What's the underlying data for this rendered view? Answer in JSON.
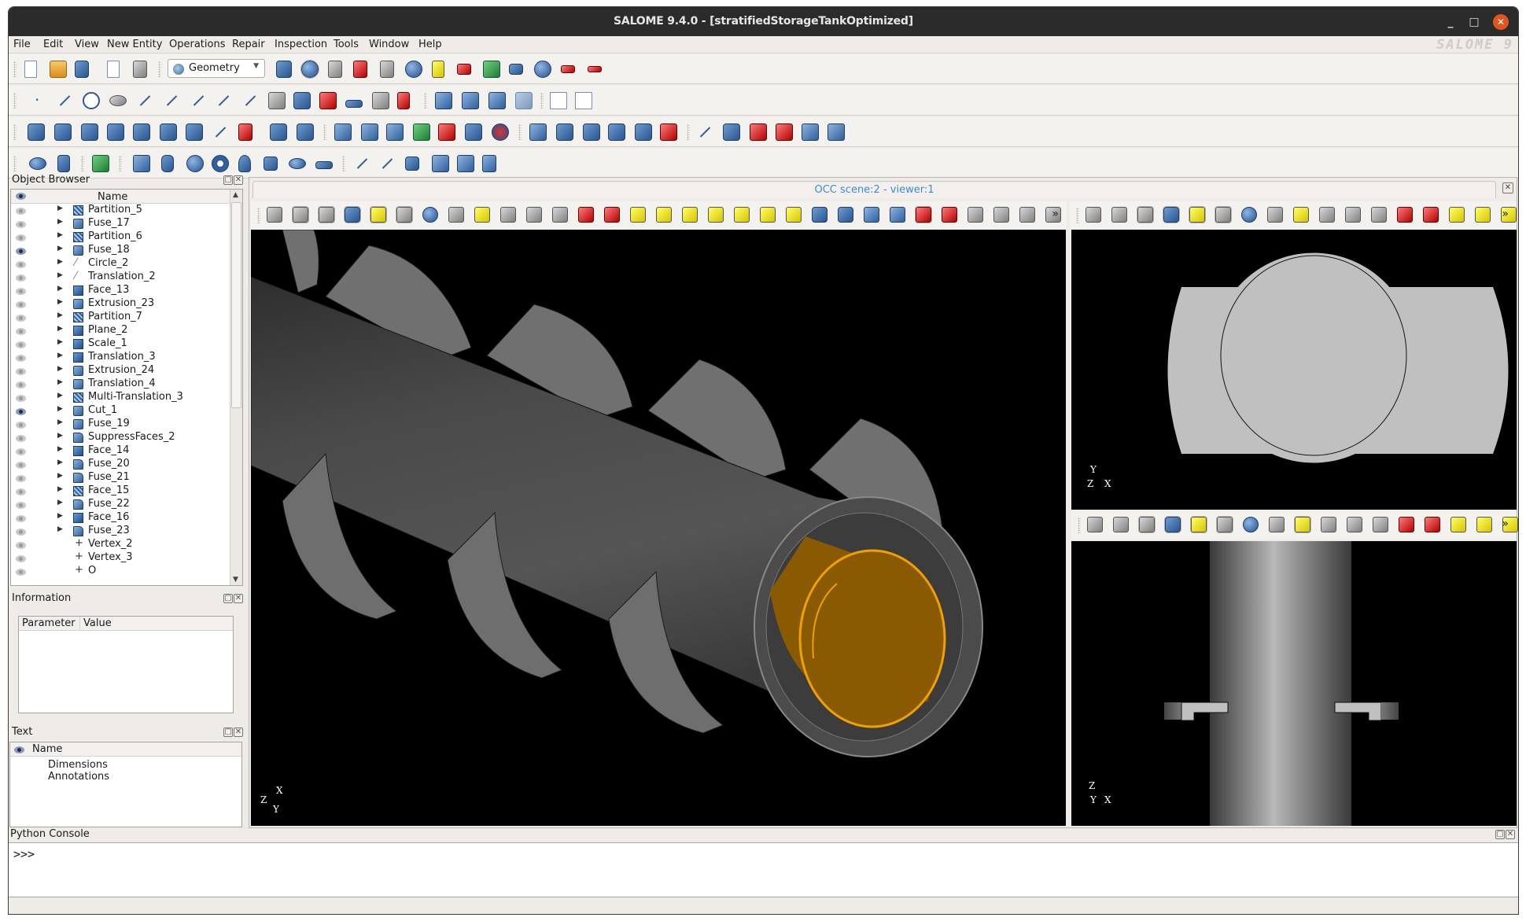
{
  "window": {
    "title": "SALOME  9.4.0 - [stratifiedStorageTankOptimized]",
    "controls": {
      "minimize": "_",
      "maximize": "□",
      "close": "✕"
    }
  },
  "menu": {
    "items": [
      "File",
      "Edit",
      "View",
      "New Entity",
      "Operations",
      "Repair",
      "Inspection",
      "Tools",
      "Window",
      "Help"
    ],
    "logo": "SALOME 9"
  },
  "toolbar": {
    "module_select": {
      "value": "Geometry",
      "icon": "geometry-icon"
    },
    "row1_icons": [
      "new-document-icon",
      "open-folder-icon",
      "save-icon",
      "copy-icon",
      "paste-icon",
      "shaper-icon",
      "geometry-icon",
      "smesh-icon",
      "paravis-icon",
      "yacs-icon",
      "jobmanager-icon",
      "homard-icon",
      "adao-icon",
      "fields-icon",
      "eficas-icon",
      "gear-icon",
      "tube-icon",
      "network-icon"
    ],
    "row2_icons": [
      "point-icon",
      "line-icon",
      "circle-icon",
      "ellipse-icon",
      "arc-icon",
      "curve-icon",
      "vector-icon",
      "plane-icon",
      "polyline-icon",
      "sketch-icon",
      "surface-icon",
      "working-plane-icon",
      "plane-lcs-icon",
      "lcs-icon",
      "lcs-axes-icon",
      "group-icon",
      "group-union-icon",
      "group-intersect-icon",
      "group-cut-icon",
      "picture-icon",
      "picture-export-icon"
    ],
    "row3_icons": [
      "translation-icon",
      "rotation-icon",
      "mirror-icon",
      "scale-icon",
      "offset-icon",
      "projection-icon",
      "projection-cylinder-icon",
      "extend-curve-icon",
      "position-icon",
      "multi-translation-icon",
      "multi-rotation-icon",
      "fuse-icon",
      "common-icon",
      "cut-icon",
      "section-icon",
      "partition-icon",
      "glue-icon",
      "shape-process-icon",
      "extrusion-icon",
      "revolution-icon",
      "filling-icon",
      "pipe-icon",
      "pipe-path-icon",
      "thickness-icon",
      "fillet-1d-icon",
      "fillet-icon",
      "chamfer-icon",
      "extrude-face-icon",
      "box-feature-icon",
      "hole-icon"
    ],
    "row4_icons": [
      "sphere-grid-icon",
      "cylinder-grid-icon",
      "surface-patch-icon",
      "box-icon",
      "cylinder-icon",
      "sphere-icon",
      "torus-icon",
      "cone-icon",
      "rectangle-icon",
      "disk-icon",
      "t-shape-icon",
      "edge-icon",
      "wire-icon",
      "face-icon",
      "shell-icon",
      "solid-icon",
      "compound-icon"
    ]
  },
  "object_browser": {
    "title": "Object Browser",
    "column": "Name",
    "items": [
      {
        "label": "Partition_5",
        "icon": "partition-icon",
        "visible": false,
        "expandable": true
      },
      {
        "label": "Fuse_17",
        "icon": "solid-icon",
        "visible": false,
        "expandable": true
      },
      {
        "label": "Partition_6",
        "icon": "partition-icon",
        "visible": false,
        "expandable": true
      },
      {
        "label": "Fuse_18",
        "icon": "solid-icon",
        "visible": true,
        "expandable": true
      },
      {
        "label": "Circle_2",
        "icon": "edge-icon",
        "visible": false,
        "expandable": true
      },
      {
        "label": "Translation_2",
        "icon": "edge-icon",
        "visible": false,
        "expandable": true
      },
      {
        "label": "Face_13",
        "icon": "face-icon",
        "visible": false,
        "expandable": true
      },
      {
        "label": "Extrusion_23",
        "icon": "solid-icon",
        "visible": false,
        "expandable": true
      },
      {
        "label": "Partition_7",
        "icon": "partition-icon",
        "visible": false,
        "expandable": true
      },
      {
        "label": "Plane_2",
        "icon": "face-icon",
        "visible": false,
        "expandable": true
      },
      {
        "label": "Scale_1",
        "icon": "face-icon",
        "visible": false,
        "expandable": true
      },
      {
        "label": "Translation_3",
        "icon": "face-icon",
        "visible": false,
        "expandable": true
      },
      {
        "label": "Extrusion_24",
        "icon": "solid-icon",
        "visible": false,
        "expandable": true
      },
      {
        "label": "Translation_4",
        "icon": "solid-icon",
        "visible": false,
        "expandable": true
      },
      {
        "label": "Multi-Translation_3",
        "icon": "partition-icon",
        "visible": false,
        "expandable": true
      },
      {
        "label": "Cut_1",
        "icon": "solid-icon",
        "visible": true,
        "expandable": true
      },
      {
        "label": "Fuse_19",
        "icon": "solid-icon",
        "visible": false,
        "expandable": true
      },
      {
        "label": "SuppressFaces_2",
        "icon": "shell-icon",
        "visible": false,
        "expandable": true
      },
      {
        "label": "Face_14",
        "icon": "face-icon",
        "visible": false,
        "expandable": true
      },
      {
        "label": "Fuse_20",
        "icon": "shell-icon",
        "visible": false,
        "expandable": true
      },
      {
        "label": "Fuse_21",
        "icon": "shell-icon",
        "visible": false,
        "expandable": true
      },
      {
        "label": "Face_15",
        "icon": "partition-icon",
        "visible": false,
        "expandable": true
      },
      {
        "label": "Fuse_22",
        "icon": "shell-icon",
        "visible": false,
        "expandable": true
      },
      {
        "label": "Face_16",
        "icon": "face-icon",
        "visible": false,
        "expandable": true
      },
      {
        "label": "Fuse_23",
        "icon": "shell-icon",
        "visible": false,
        "expandable": true
      },
      {
        "label": "Vertex_2",
        "icon": "vertex-icon",
        "visible": false,
        "expandable": false
      },
      {
        "label": "Vertex_3",
        "icon": "vertex-icon",
        "visible": false,
        "expandable": false
      },
      {
        "label": "O",
        "icon": "vertex-icon",
        "visible": false,
        "expandable": false
      }
    ]
  },
  "information": {
    "title": "Information",
    "columns": [
      "Parameter",
      "Value"
    ],
    "rows": []
  },
  "text_panel": {
    "title": "Text",
    "column": "Name",
    "items": [
      "Dimensions",
      "Annotations"
    ]
  },
  "viewer": {
    "tab_title": "OCC scene:2 - viewer:1",
    "main_toolbar_icons": [
      "dump-view-icon",
      "interaction-style-icon",
      "zooming-style-icon",
      "preselection-icon",
      "selection-icon",
      "rectangle-selection-icon",
      "polygon-selection-icon",
      "circle-selection-icon",
      "trihedron-icon",
      "fit-all-icon",
      "fit-area-icon",
      "fit-selection-icon",
      "zoom-icon",
      "pan-icon",
      "global-pan-icon",
      "rotation-point-icon",
      "rotate-icon",
      "front-view-icon",
      "back-view-icon",
      "top-view-icon",
      "bottom-view-icon",
      "left-view-icon",
      "right-view-icon",
      "anticlockwise-icon",
      "clockwise-icon",
      "reset-icon",
      "shading-icon",
      "stereo-icon",
      "clipping-icon",
      "graduated-axes-icon",
      "ambient-icon"
    ],
    "side_toolbar_icons": [
      "dump-view-icon",
      "interaction-style-icon",
      "zooming-style-icon",
      "preselection-icon",
      "selection-icon",
      "rectangle-selection-icon",
      "polygon-selection-icon",
      "circle-selection-icon",
      "trihedron-icon",
      "fit-all-icon",
      "fit-area-icon",
      "fit-selection-icon",
      "zoom-icon",
      "pan-icon",
      "global-pan-icon",
      "graduated-axes-icon",
      "ambient-icon"
    ],
    "more": "»",
    "views": {
      "main": {
        "axes": [
          "X",
          "Z",
          "Y"
        ]
      },
      "top_right": {
        "axes": [
          "Y",
          "Z",
          "X"
        ]
      },
      "bottom_right": {
        "axes": [
          "Z",
          "Y",
          "X"
        ]
      }
    },
    "colors": {
      "background": "#000000",
      "solid": "#6e6e6e",
      "inner_tube": "#8a5a00",
      "highlight_edge": "#f0a000",
      "section_fill": "#c0c0c0"
    }
  },
  "python_console": {
    "title": "Python Console",
    "prompt": ">>>"
  }
}
